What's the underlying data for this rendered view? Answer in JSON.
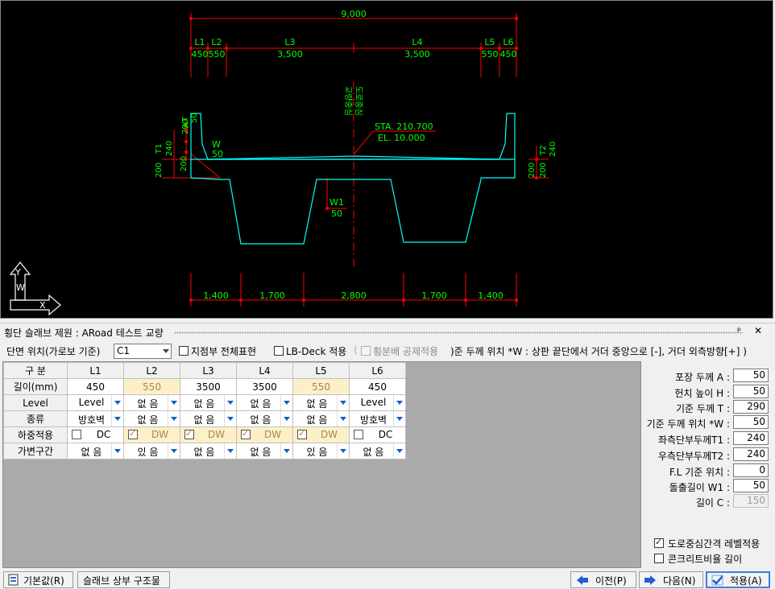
{
  "drawing": {
    "total_width_label": "9,000",
    "top_dims": [
      {
        "name": "L1",
        "value": "450"
      },
      {
        "name": "L2",
        "value": "550"
      },
      {
        "name": "L3",
        "value": "3,500"
      },
      {
        "name": "L4",
        "value": "3,500"
      },
      {
        "name": "L5",
        "value": "550"
      },
      {
        "name": "L6",
        "value": "450"
      }
    ],
    "bottom_dims": [
      "1,400",
      "1,700",
      "2,800",
      "1,700",
      "1,400"
    ],
    "center_label_1": "교량중심",
    "center_label_2": "도로중심",
    "station_label": "STA. 210.700",
    "elevation_label": "EL.  10.000",
    "left_labels": {
      "T": "T",
      "A": "A",
      "A_val": "50",
      "T_val": "290",
      "T1": "T1",
      "T1_val": "240",
      "l200a": "200",
      "l200b": "200",
      "W": "W",
      "W_val": "50"
    },
    "right_labels": {
      "T2": "T2",
      "T2_val": "240",
      "r200": "200",
      "r200b": "200"
    },
    "w1_label": "W1",
    "w1_val": "50",
    "axis_y": "Y",
    "axis_w": "W",
    "axis_x": "X"
  },
  "panel": {
    "title": "횡단 슬래브 제원 : ARoad 테스트 교량",
    "pin_glyph": "ᵖ",
    "close_glyph": "✕"
  },
  "options": {
    "section_pos_label": "단면 위치(가로보 기준)",
    "section_pos_value": "C1",
    "fulcrum_label": "지점부 전체표현",
    "lbdeck_label": "LB-Deck 적용",
    "deduct_label": "횡분배 공제적용",
    "note": ")준 두께 위치  *W : 상판 끝단에서 거더 중앙으로 [-], 거더 외측방향[+] )"
  },
  "grid": {
    "headers": [
      "구 분",
      "L1",
      "L2",
      "L3",
      "L4",
      "L5",
      "L6"
    ],
    "rows": [
      {
        "label": "길이(mm)",
        "cells": [
          "450",
          "550",
          "3500",
          "3500",
          "550",
          "450"
        ]
      },
      {
        "label": "Level",
        "cells": [
          "Level",
          "없 음",
          "없 음",
          "없 음",
          "없 음",
          "Level"
        ]
      },
      {
        "label": "종류",
        "cells": [
          "방호벽",
          "없 음",
          "없 음",
          "없 음",
          "없 음",
          "방호벽"
        ]
      },
      {
        "label": "하중적용",
        "cells": [
          "DC",
          "DW",
          "DW",
          "DW",
          "DW",
          "DC"
        ]
      },
      {
        "label": "가변구간",
        "cells": [
          "없 음",
          "있 음",
          "없 음",
          "없 음",
          "있 음",
          "없 음"
        ]
      }
    ]
  },
  "params": [
    {
      "label": "포장 두께 A :",
      "value": "50"
    },
    {
      "label": "헌치 높이 H :",
      "value": "50"
    },
    {
      "label": "기준 두께 T :",
      "value": "290"
    },
    {
      "label": "기준 두께 위치 *W :",
      "value": "50"
    },
    {
      "label": "좌측단부두께T1 :",
      "value": "240"
    },
    {
      "label": "우측단부두께T2 :",
      "value": "240"
    },
    {
      "label": "F.L 기준 위치 :",
      "value": "0"
    },
    {
      "label": "돌출길이 W1 :",
      "value": "50"
    },
    {
      "label": "길이 C :",
      "value": "150"
    }
  ],
  "checks": {
    "road_center_level": "도로중심간격 레벨적용",
    "concrete_ratio": "콘크리트비율 길이"
  },
  "buttons": {
    "default": "기본값(R)",
    "slab_upper": "슬래브 상부 구조물",
    "prev": "이전(P)",
    "next": "다음(N)",
    "apply": "적용(A)"
  },
  "colors": {
    "dim": "#ff0000",
    "text_green": "#00ff00",
    "section": "#00ffff",
    "bg": "#000000"
  }
}
